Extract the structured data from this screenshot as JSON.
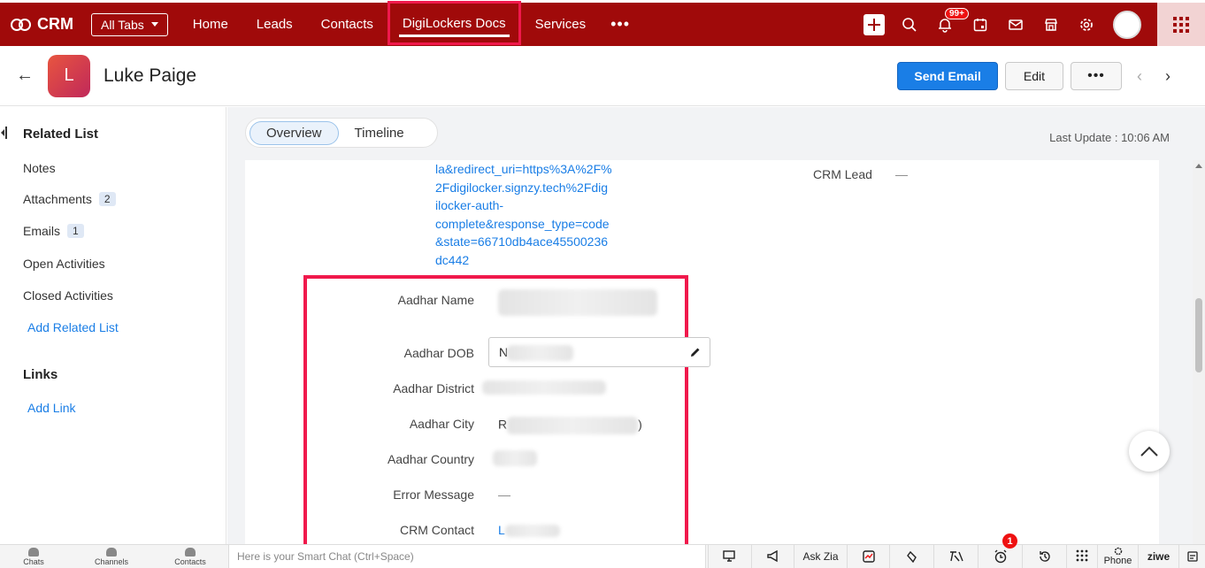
{
  "nav": {
    "brand": "CRM",
    "all_tabs": "All Tabs",
    "links": [
      "Home",
      "Leads",
      "Contacts",
      "DigiLockers Docs",
      "Services"
    ],
    "more": "•••",
    "notification_badge": "99+"
  },
  "record": {
    "avatar_letter": "L",
    "name": "Luke Paige",
    "send_email": "Send Email",
    "edit": "Edit",
    "more": "•••"
  },
  "sidebar": {
    "related_list": "Related List",
    "items": [
      {
        "label": "Notes",
        "count": ""
      },
      {
        "label": "Attachments",
        "count": "2"
      },
      {
        "label": "Emails",
        "count": "1"
      },
      {
        "label": "Open Activities",
        "count": ""
      },
      {
        "label": "Closed Activities",
        "count": ""
      }
    ],
    "add_related_list": "Add Related List",
    "links": "Links",
    "add_link": "Add Link"
  },
  "main": {
    "tabs": [
      "Overview",
      "Timeline"
    ],
    "last_update": "Last Update : 10:06 AM",
    "url_lines": [
      "la&redirect_uri=https%3A%2F%",
      "2Fdigilocker.signzy.tech%2Fdig",
      "ilocker-auth-",
      "complete&response_type=code",
      "&state=66710db4ace45500236",
      "dc442"
    ],
    "crm_lead_label": "CRM Lead",
    "crm_lead_value": "—",
    "fields": [
      {
        "label": "Aadhar Name",
        "value": ""
      },
      {
        "label": "Aadhar DOB",
        "value": "N"
      },
      {
        "label": "Aadhar District",
        "value": ""
      },
      {
        "label": "Aadhar City",
        "value": "R",
        "suffix": ")"
      },
      {
        "label": "Aadhar Country",
        "value": ""
      },
      {
        "label": "Error Message",
        "value": "—"
      },
      {
        "label": "CRM Contact",
        "value": "L"
      }
    ]
  },
  "bottom": {
    "chats": "Chats",
    "channels": "Channels",
    "contacts": "Contacts",
    "smart_chat_placeholder": "Here is your Smart Chat (Ctrl+Space)",
    "ask_zia": "Ask Zia",
    "phone": "Phone",
    "zia_brand": "ziwe",
    "reminder_count": "1"
  },
  "colors": {
    "nav_bg": "#a00a0a",
    "highlight": "#f0194c",
    "primary": "#1a7ee6"
  }
}
